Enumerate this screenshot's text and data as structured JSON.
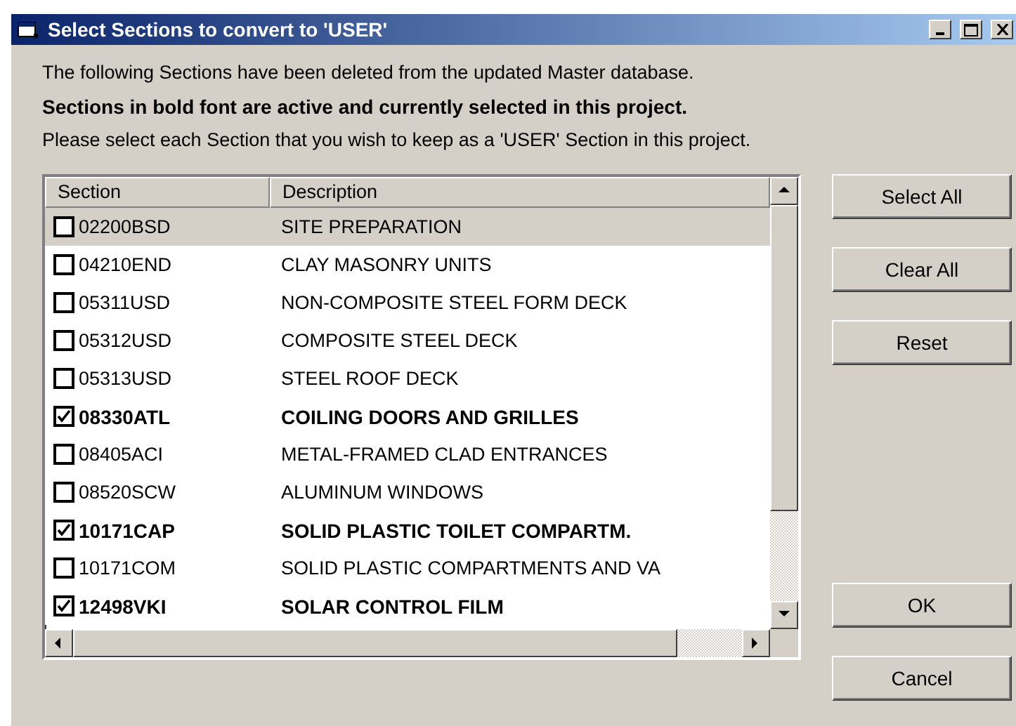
{
  "window": {
    "title": "Select Sections to convert to 'USER'"
  },
  "intro": [
    {
      "text": "The following Sections have been deleted from the updated Master database.",
      "bold": false
    },
    {
      "text": "Sections in bold font are active and currently selected in this project.",
      "bold": true
    },
    {
      "text": "Please select each Section that you wish to keep as a 'USER' Section in this project.",
      "bold": false
    }
  ],
  "table": {
    "columns": [
      "Section",
      "Description"
    ],
    "rows": [
      {
        "section": "02200BSD",
        "description": "SITE PREPARATION",
        "checked": false,
        "active": false,
        "selected": true
      },
      {
        "section": "04210END",
        "description": "CLAY MASONRY UNITS",
        "checked": false,
        "active": false,
        "selected": false
      },
      {
        "section": "05311USD",
        "description": "NON-COMPOSITE STEEL FORM DECK",
        "checked": false,
        "active": false,
        "selected": false
      },
      {
        "section": "05312USD",
        "description": "COMPOSITE STEEL DECK",
        "checked": false,
        "active": false,
        "selected": false
      },
      {
        "section": "05313USD",
        "description": "STEEL ROOF DECK",
        "checked": false,
        "active": false,
        "selected": false
      },
      {
        "section": "08330ATL",
        "description": "COILING DOORS AND GRILLES",
        "checked": true,
        "active": true,
        "selected": false
      },
      {
        "section": "08405ACI",
        "description": "METAL-FRAMED CLAD ENTRANCES",
        "checked": false,
        "active": false,
        "selected": false
      },
      {
        "section": "08520SCW",
        "description": "ALUMINUM WINDOWS",
        "checked": false,
        "active": false,
        "selected": false
      },
      {
        "section": "10171CAP",
        "description": "SOLID PLASTIC TOILET COMPARTM.",
        "checked": true,
        "active": true,
        "selected": false
      },
      {
        "section": "10171COM",
        "description": "SOLID PLASTIC COMPARTMENTS AND VA",
        "checked": false,
        "active": false,
        "selected": false
      },
      {
        "section": "12498VKI",
        "description": "SOLAR CONTROL FILM",
        "checked": true,
        "active": true,
        "selected": false
      }
    ]
  },
  "buttons_top": [
    "Select All",
    "Clear All",
    "Reset"
  ],
  "buttons_bottom": [
    "OK",
    "Cancel"
  ]
}
